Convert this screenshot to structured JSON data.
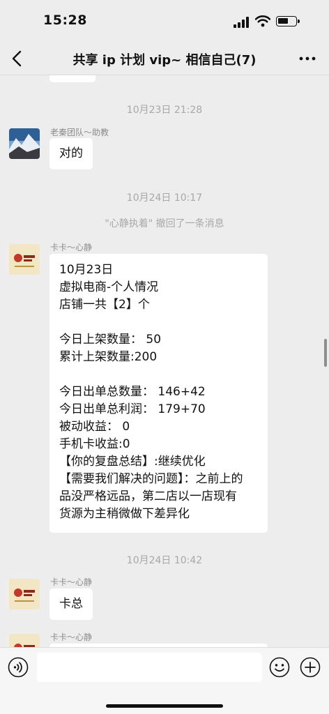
{
  "status_bar": {
    "time": "15:28"
  },
  "header": {
    "title": "共享 ip 计划 vip~ 相信自己(7)"
  },
  "messages": {
    "ts1": "10月23日 21:28",
    "m1": {
      "sender": "老秦团队～助教",
      "text": "对的"
    },
    "ts2": "10月24日 10:17",
    "recall": "\"心静执着\" 撤回了一条消息",
    "m2": {
      "sender": "卡卡～心静",
      "lines": [
        "10月23日",
        "虚拟电商-个人情况",
        "店铺一共【2】个",
        "",
        "今日上架数量： 50",
        "累计上架数量:200",
        "",
        "今日出单总数量： 146+42",
        "今日出单总利润： 179+70",
        "被动收益： 0",
        "手机卡收益:0",
        "【你的复盘总结】:继续优化",
        "【需要我们解决的问题】：之前上的",
        "品没严格远品，第二店以一店现有",
        "货源为主稍微做下差异化"
      ]
    },
    "ts3": "10月24日 10:42",
    "m3": {
      "sender": "卡卡～心静",
      "text": "卡总"
    },
    "m4": {
      "sender": "卡卡～心静"
    }
  },
  "input": {
    "value": ""
  },
  "colors": {
    "background": "#ededed",
    "bubble": "#ffffff",
    "meta_text": "#a8a8a8"
  },
  "icons": [
    "back-icon",
    "more-icon",
    "voice-icon",
    "emoji-icon",
    "plus-icon"
  ]
}
